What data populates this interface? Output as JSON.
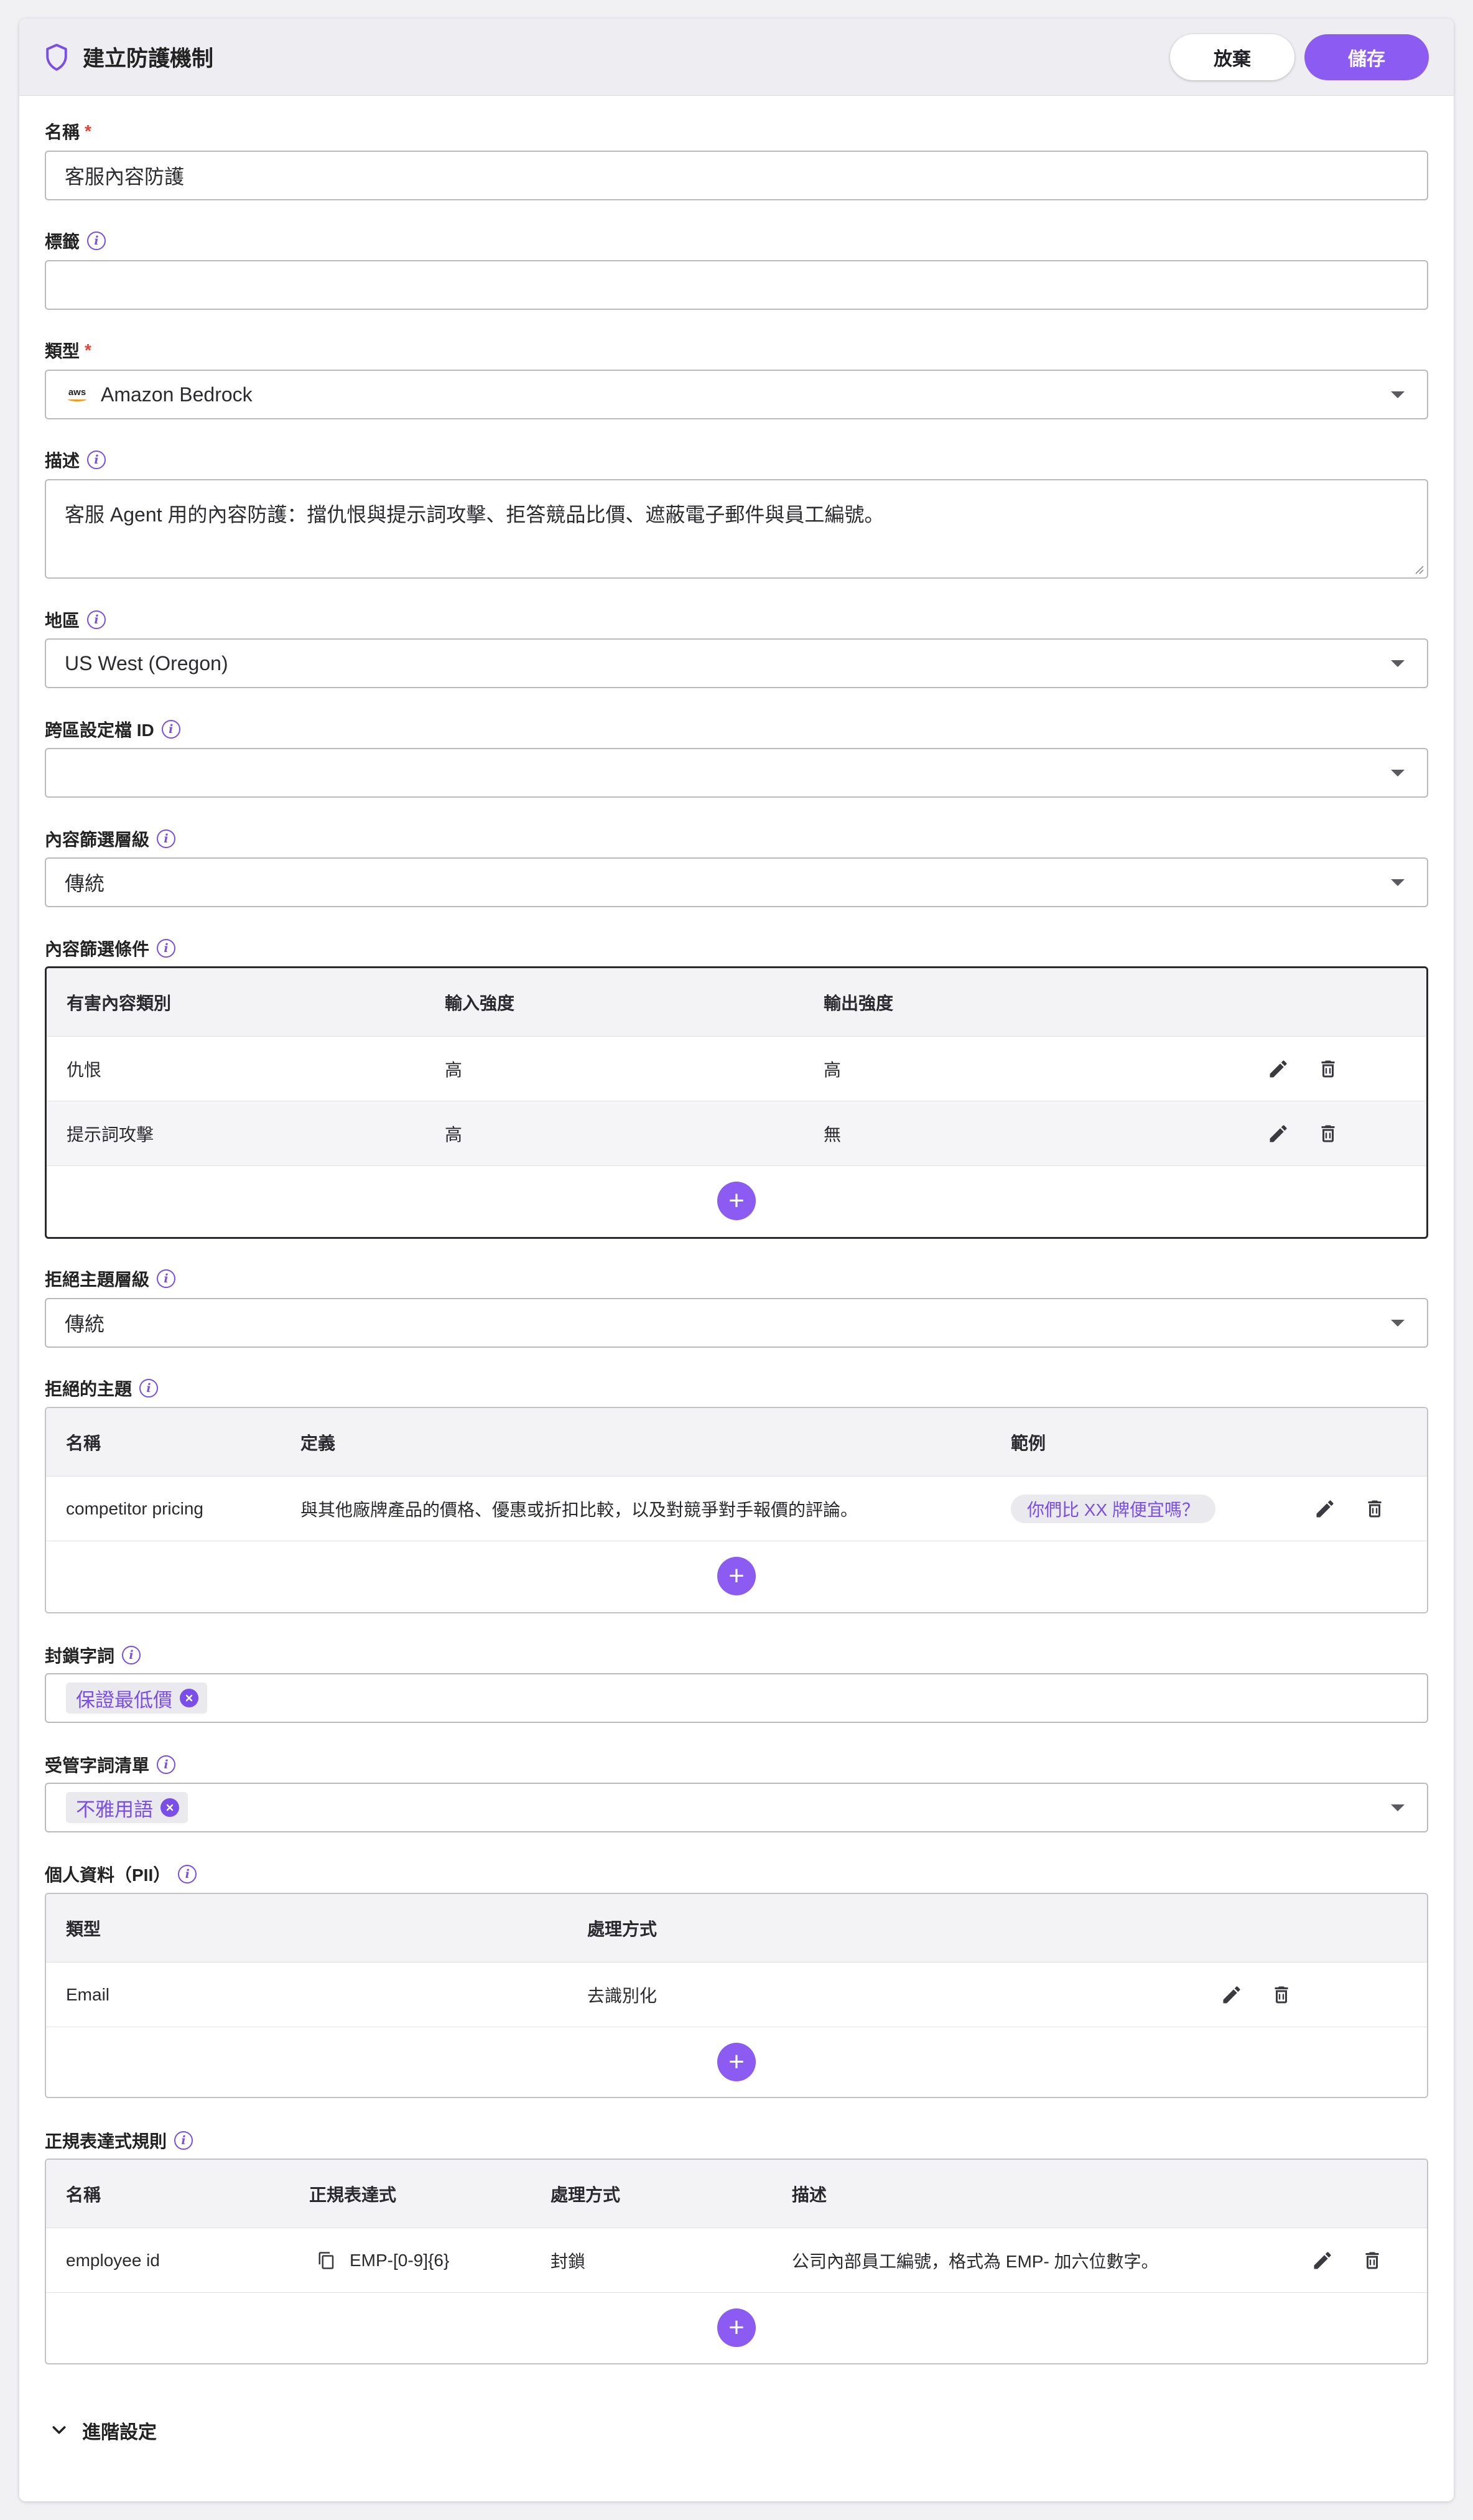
{
  "header": {
    "title": "建立防護機制",
    "discard_label": "放棄",
    "save_label": "儲存"
  },
  "fields": {
    "name": {
      "label": "名稱",
      "required_mark": "*",
      "value": "客服內容防護"
    },
    "tags": {
      "label": "標籤",
      "value": ""
    },
    "type": {
      "label": "類型",
      "required_mark": "*",
      "value": "Amazon Bedrock",
      "logo_text": "aws"
    },
    "description": {
      "label": "描述",
      "value": "客服 Agent 用的內容防護：擋仇恨與提示詞攻擊、拒答競品比價、遮蔽電子郵件與員工編號。"
    },
    "region": {
      "label": "地區",
      "value": "US West (Oregon)"
    },
    "cross_region_profile": {
      "label": "跨區設定檔 ID",
      "value": ""
    },
    "content_filter_tier": {
      "label": "內容篩選層級",
      "value": "傳統"
    },
    "denied_topic_tier": {
      "label": "拒絕主題層級",
      "value": "傳統"
    }
  },
  "content_filters": {
    "label": "內容篩選條件",
    "headers": [
      "有害內容類別",
      "輸入強度",
      "輸出強度"
    ],
    "rows": [
      {
        "category": "仇恨",
        "input": "高",
        "output": "高"
      },
      {
        "category": "提示詞攻擊",
        "input": "高",
        "output": "無"
      }
    ],
    "add_label": "+"
  },
  "denied_topics": {
    "label": "拒絕的主題",
    "headers": [
      "名稱",
      "定義",
      "範例"
    ],
    "rows": [
      {
        "name": "competitor pricing",
        "definition": "與其他廠牌產品的價格、優惠或折扣比較，以及對競爭對手報價的評論。",
        "example": "你們比 XX 牌便宜嗎？"
      }
    ],
    "add_label": "+"
  },
  "blocked_words": {
    "label": "封鎖字詞",
    "tags": [
      "保證最低價"
    ]
  },
  "managed_word_lists": {
    "label": "受管字詞清單",
    "tags": [
      "不雅用語"
    ]
  },
  "pii": {
    "label": "個人資料（PII）",
    "headers": [
      "類型",
      "處理方式"
    ],
    "rows": [
      {
        "type": "Email",
        "action": "去識別化"
      }
    ],
    "add_label": "+"
  },
  "regex_rules": {
    "label": "正規表達式規則",
    "headers": [
      "名稱",
      "正規表達式",
      "處理方式",
      "描述"
    ],
    "rows": [
      {
        "name": "employee id",
        "pattern": "EMP-[0-9]{6}",
        "action": "封鎖",
        "description": "公司內部員工編號，格式為 EMP- 加六位數字。"
      }
    ],
    "add_label": "+"
  },
  "advanced": {
    "label": "進階設定"
  },
  "colors": {
    "accent": "#8c5cf2",
    "required": "#e0443a",
    "info": "#7a4ee8"
  },
  "icons": [
    "shield-icon",
    "info-icon",
    "aws-logo",
    "chevron-down-icon",
    "edit-icon",
    "delete-icon",
    "add-icon",
    "copy-icon",
    "remove-tag-icon",
    "expand-icon"
  ]
}
